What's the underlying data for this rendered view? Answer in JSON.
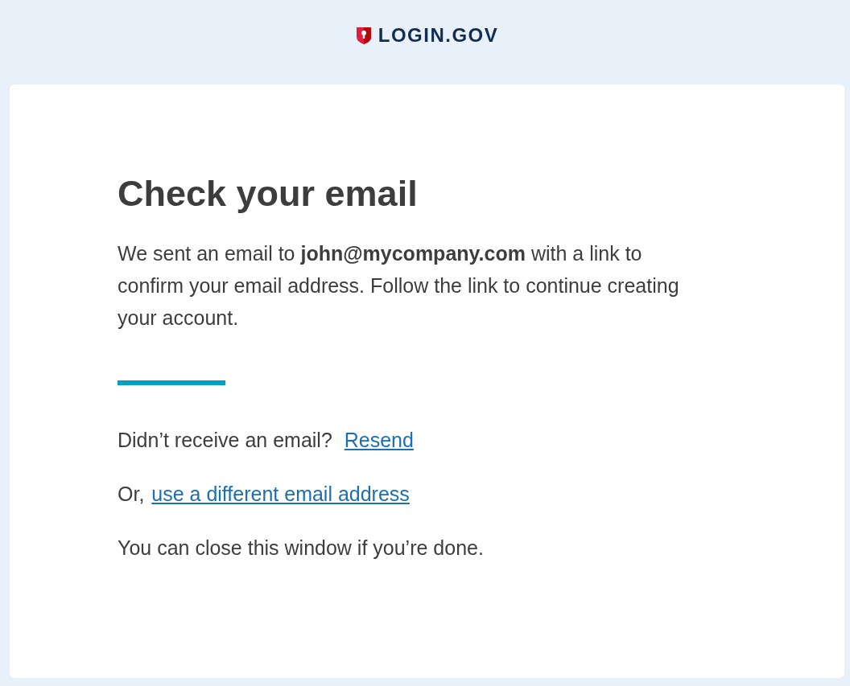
{
  "header": {
    "logo_text": "LOGIN.GOV"
  },
  "heading": "Check your email",
  "message": "We sent an email to **john@mycompany.com** with a link to confirm your email address. Follow the link to continue creating your account.",
  "resend": {
    "prompt": "Didn’t receive an email?",
    "link": "Resend"
  },
  "different": {
    "prompt": "Or,",
    "link": "use a different email address"
  },
  "footer_note": "You can close this window if you’re done."
}
